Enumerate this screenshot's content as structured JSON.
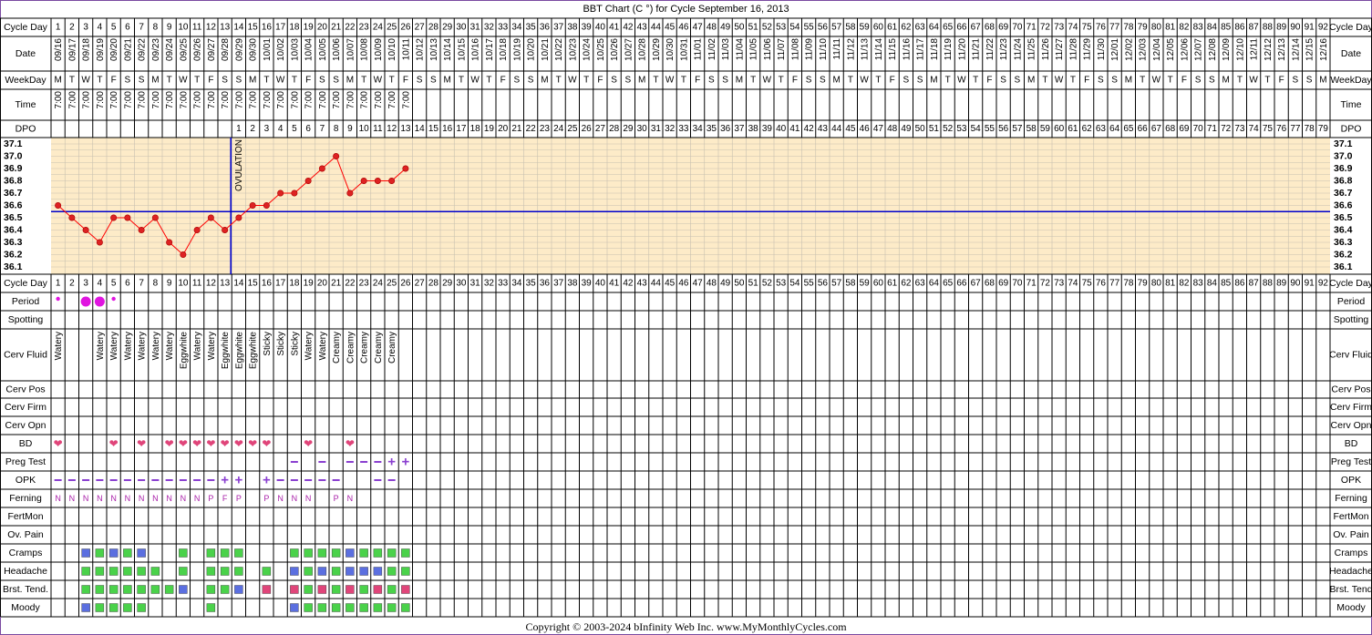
{
  "title": "BBT Chart (C °) for Cycle September 16, 2013",
  "copyright": "Copyright © 2003-2024 bInfinity Web Inc.     www.MyMonthlyCycles.com",
  "colors": {
    "chart_bg": "#fdebc8",
    "grid": "#c8c0b0",
    "temp_line": "#ff0000",
    "temp_dot": "#dd2222",
    "coverline": "#0000cc",
    "ovulation_line": "#0000cc",
    "period": "#e014e0",
    "heart": "#e0457a",
    "test_mark": "#8a3fd0",
    "ferning_text": "#aa22aa",
    "green": "#4ad24a",
    "blue": "#5b6fe0",
    "pink": "#e0457a",
    "border": "#7a4aa0"
  },
  "labels": {
    "cycle_day": "Cycle Day",
    "date": "Date",
    "weekday": "WeekDay",
    "time": "Time",
    "dpo": "DPO",
    "period": "Period",
    "spotting": "Spotting",
    "cerv_fluid": "Cerv Fluid",
    "cerv_pos": "Cerv Pos",
    "cerv_firm": "Cerv Firm",
    "cerv_opn": "Cerv Opn",
    "bd": "BD",
    "preg_test": "Preg Test",
    "opk": "OPK",
    "ferning": "Ferning",
    "fertmon": "FertMon",
    "ov_pain": "Ov. Pain",
    "cramps": "Cramps",
    "headache": "Headache",
    "brst_tend_left": "Brst. Tend.",
    "brst_tend_right": "Brst. Tend",
    "moody": "Moody"
  },
  "chart_data": {
    "type": "line",
    "title": "BBT Chart (C °) for Cycle September 16, 2013",
    "num_days": 92,
    "start_date": "2013-09-16",
    "dates": [
      "09/16",
      "09/17",
      "09/18",
      "09/19",
      "09/20",
      "09/21",
      "09/22",
      "09/23",
      "09/24",
      "09/25",
      "09/26",
      "09/27",
      "09/28",
      "09/29",
      "09/30",
      "10/01",
      "10/02",
      "10/03",
      "10/04",
      "10/05",
      "10/06",
      "10/07",
      "10/08",
      "10/09",
      "10/10",
      "10/11",
      "10/12",
      "10/13",
      "10/14",
      "10/15",
      "10/16",
      "10/17",
      "10/18",
      "10/19",
      "10/20",
      "10/21",
      "10/22",
      "10/23",
      "10/24",
      "10/25",
      "10/26",
      "10/27",
      "10/28",
      "10/29",
      "10/30",
      "10/31",
      "11/01",
      "11/02",
      "11/03",
      "11/04",
      "11/05",
      "11/06",
      "11/07",
      "11/08",
      "11/09",
      "11/10",
      "11/11",
      "11/12",
      "11/13",
      "11/14",
      "11/15",
      "11/16",
      "11/17",
      "11/18",
      "11/19",
      "11/20",
      "11/21",
      "11/22",
      "11/23",
      "11/24",
      "11/25",
      "11/26",
      "11/27",
      "11/28",
      "11/29",
      "11/30",
      "12/01",
      "12/02",
      "12/03",
      "12/04",
      "12/05",
      "12/06",
      "12/07",
      "12/08",
      "12/09",
      "12/10",
      "12/11",
      "12/12",
      "12/13",
      "12/14",
      "12/15",
      "12/16"
    ],
    "weekdays": [
      "M",
      "T",
      "W",
      "T",
      "F",
      "S",
      "S"
    ],
    "time_label": "7:00",
    "time_days": 26,
    "dpo_start_day": 14,
    "dpo_max": 79,
    "y_ticks": [
      "37.1",
      "37.0",
      "36.9",
      "36.8",
      "36.7",
      "36.6",
      "36.5",
      "36.4",
      "36.3",
      "36.2",
      "36.1"
    ],
    "ylim": [
      36.1,
      37.1
    ],
    "temps": [
      36.6,
      36.5,
      36.4,
      36.3,
      36.5,
      36.5,
      36.4,
      36.5,
      36.3,
      36.2,
      36.4,
      36.5,
      36.4,
      36.5,
      36.6,
      36.6,
      36.7,
      36.7,
      36.8,
      36.9,
      37.0,
      36.7,
      36.8,
      36.8,
      36.8,
      36.9
    ],
    "coverline": 36.55,
    "ovulation_day": 13,
    "ovulation_label": "OVULATION"
  },
  "period": [
    {
      "day": 1,
      "size": "s"
    },
    {
      "day": 3,
      "size": "l"
    },
    {
      "day": 4,
      "size": "l"
    },
    {
      "day": 5,
      "size": "s"
    }
  ],
  "cerv_fluid": [
    {
      "day": 1,
      "v": "Watery"
    },
    {
      "day": 4,
      "v": "Watery"
    },
    {
      "day": 5,
      "v": "Watery"
    },
    {
      "day": 6,
      "v": "Watery"
    },
    {
      "day": 7,
      "v": "Watery"
    },
    {
      "day": 8,
      "v": "Watery"
    },
    {
      "day": 9,
      "v": "Watery"
    },
    {
      "day": 10,
      "v": "Eggwhite"
    },
    {
      "day": 11,
      "v": "Watery"
    },
    {
      "day": 12,
      "v": "Watery"
    },
    {
      "day": 13,
      "v": "Eggwhite"
    },
    {
      "day": 14,
      "v": "Eggwhite"
    },
    {
      "day": 15,
      "v": "Eggwhite"
    },
    {
      "day": 16,
      "v": "Sticky"
    },
    {
      "day": 17,
      "v": "Sticky"
    },
    {
      "day": 18,
      "v": "Sticky"
    },
    {
      "day": 19,
      "v": "Watery"
    },
    {
      "day": 20,
      "v": "Watery"
    },
    {
      "day": 21,
      "v": "Creamy"
    },
    {
      "day": 22,
      "v": "Creamy"
    },
    {
      "day": 23,
      "v": "Creamy"
    },
    {
      "day": 24,
      "v": "Creamy"
    },
    {
      "day": 25,
      "v": "Creamy"
    }
  ],
  "bd": [
    1,
    5,
    7,
    9,
    10,
    11,
    12,
    13,
    14,
    15,
    16,
    19,
    22
  ],
  "heart_glyph": "❤",
  "preg_test": [
    {
      "day": 18,
      "v": "−"
    },
    {
      "day": 20,
      "v": "−"
    },
    {
      "day": 22,
      "v": "−"
    },
    {
      "day": 23,
      "v": "−"
    },
    {
      "day": 24,
      "v": "−"
    },
    {
      "day": 25,
      "v": "+"
    },
    {
      "day": 26,
      "v": "+"
    }
  ],
  "opk": [
    {
      "day": 1,
      "v": "−"
    },
    {
      "day": 2,
      "v": "−"
    },
    {
      "day": 3,
      "v": "−"
    },
    {
      "day": 4,
      "v": "−"
    },
    {
      "day": 5,
      "v": "−"
    },
    {
      "day": 6,
      "v": "−"
    },
    {
      "day": 7,
      "v": "−"
    },
    {
      "day": 8,
      "v": "−"
    },
    {
      "day": 9,
      "v": "−"
    },
    {
      "day": 10,
      "v": "−"
    },
    {
      "day": 11,
      "v": "−"
    },
    {
      "day": 12,
      "v": "−"
    },
    {
      "day": 13,
      "v": "+"
    },
    {
      "day": 14,
      "v": "+"
    },
    {
      "day": 16,
      "v": "+"
    },
    {
      "day": 17,
      "v": "−"
    },
    {
      "day": 18,
      "v": "−"
    },
    {
      "day": 19,
      "v": "−"
    },
    {
      "day": 20,
      "v": "−"
    },
    {
      "day": 21,
      "v": "−"
    },
    {
      "day": 24,
      "v": "−"
    },
    {
      "day": 25,
      "v": "−"
    }
  ],
  "ferning": [
    {
      "day": 1,
      "v": "N"
    },
    {
      "day": 2,
      "v": "N"
    },
    {
      "day": 3,
      "v": "N"
    },
    {
      "day": 4,
      "v": "N"
    },
    {
      "day": 5,
      "v": "N"
    },
    {
      "day": 6,
      "v": "N"
    },
    {
      "day": 7,
      "v": "N"
    },
    {
      "day": 8,
      "v": "N"
    },
    {
      "day": 9,
      "v": "N"
    },
    {
      "day": 10,
      "v": "N"
    },
    {
      "day": 11,
      "v": "N"
    },
    {
      "day": 12,
      "v": "P"
    },
    {
      "day": 13,
      "v": "F"
    },
    {
      "day": 14,
      "v": "P"
    },
    {
      "day": 16,
      "v": "P"
    },
    {
      "day": 17,
      "v": "N"
    },
    {
      "day": 18,
      "v": "N"
    },
    {
      "day": 19,
      "v": "N"
    },
    {
      "day": 21,
      "v": "P"
    },
    {
      "day": 22,
      "v": "N"
    }
  ],
  "symptoms": {
    "cramps": [
      {
        "day": 3,
        "c": "blue"
      },
      {
        "day": 4,
        "c": "green"
      },
      {
        "day": 5,
        "c": "blue"
      },
      {
        "day": 6,
        "c": "green"
      },
      {
        "day": 7,
        "c": "blue"
      },
      {
        "day": 10,
        "c": "green"
      },
      {
        "day": 12,
        "c": "green"
      },
      {
        "day": 13,
        "c": "green"
      },
      {
        "day": 14,
        "c": "green"
      },
      {
        "day": 18,
        "c": "green"
      },
      {
        "day": 19,
        "c": "green"
      },
      {
        "day": 20,
        "c": "green"
      },
      {
        "day": 21,
        "c": "green"
      },
      {
        "day": 22,
        "c": "blue"
      },
      {
        "day": 23,
        "c": "green"
      },
      {
        "day": 24,
        "c": "green"
      },
      {
        "day": 25,
        "c": "green"
      },
      {
        "day": 26,
        "c": "green"
      }
    ],
    "headache": [
      {
        "day": 3,
        "c": "green"
      },
      {
        "day": 4,
        "c": "green"
      },
      {
        "day": 5,
        "c": "green"
      },
      {
        "day": 6,
        "c": "green"
      },
      {
        "day": 7,
        "c": "green"
      },
      {
        "day": 8,
        "c": "green"
      },
      {
        "day": 10,
        "c": "green"
      },
      {
        "day": 12,
        "c": "green"
      },
      {
        "day": 13,
        "c": "green"
      },
      {
        "day": 14,
        "c": "green"
      },
      {
        "day": 16,
        "c": "green"
      },
      {
        "day": 18,
        "c": "blue"
      },
      {
        "day": 19,
        "c": "green"
      },
      {
        "day": 20,
        "c": "blue"
      },
      {
        "day": 21,
        "c": "green"
      },
      {
        "day": 22,
        "c": "blue"
      },
      {
        "day": 23,
        "c": "blue"
      },
      {
        "day": 24,
        "c": "blue"
      },
      {
        "day": 25,
        "c": "green"
      },
      {
        "day": 26,
        "c": "green"
      }
    ],
    "brst_tend": [
      {
        "day": 3,
        "c": "green"
      },
      {
        "day": 4,
        "c": "green"
      },
      {
        "day": 5,
        "c": "green"
      },
      {
        "day": 6,
        "c": "green"
      },
      {
        "day": 7,
        "c": "green"
      },
      {
        "day": 8,
        "c": "green"
      },
      {
        "day": 9,
        "c": "green"
      },
      {
        "day": 10,
        "c": "blue"
      },
      {
        "day": 12,
        "c": "green"
      },
      {
        "day": 13,
        "c": "green"
      },
      {
        "day": 14,
        "c": "blue"
      },
      {
        "day": 16,
        "c": "pink"
      },
      {
        "day": 18,
        "c": "pink"
      },
      {
        "day": 19,
        "c": "green"
      },
      {
        "day": 20,
        "c": "pink"
      },
      {
        "day": 21,
        "c": "green"
      },
      {
        "day": 22,
        "c": "pink"
      },
      {
        "day": 23,
        "c": "green"
      },
      {
        "day": 24,
        "c": "pink"
      },
      {
        "day": 25,
        "c": "green"
      },
      {
        "day": 26,
        "c": "pink"
      }
    ],
    "moody": [
      {
        "day": 3,
        "c": "blue"
      },
      {
        "day": 4,
        "c": "green"
      },
      {
        "day": 5,
        "c": "green"
      },
      {
        "day": 6,
        "c": "green"
      },
      {
        "day": 7,
        "c": "green"
      },
      {
        "day": 12,
        "c": "green"
      },
      {
        "day": 18,
        "c": "blue"
      },
      {
        "day": 19,
        "c": "green"
      },
      {
        "day": 20,
        "c": "green"
      },
      {
        "day": 21,
        "c": "green"
      },
      {
        "day": 22,
        "c": "green"
      },
      {
        "day": 23,
        "c": "green"
      },
      {
        "day": 24,
        "c": "green"
      },
      {
        "day": 25,
        "c": "green"
      },
      {
        "day": 26,
        "c": "green"
      }
    ]
  }
}
